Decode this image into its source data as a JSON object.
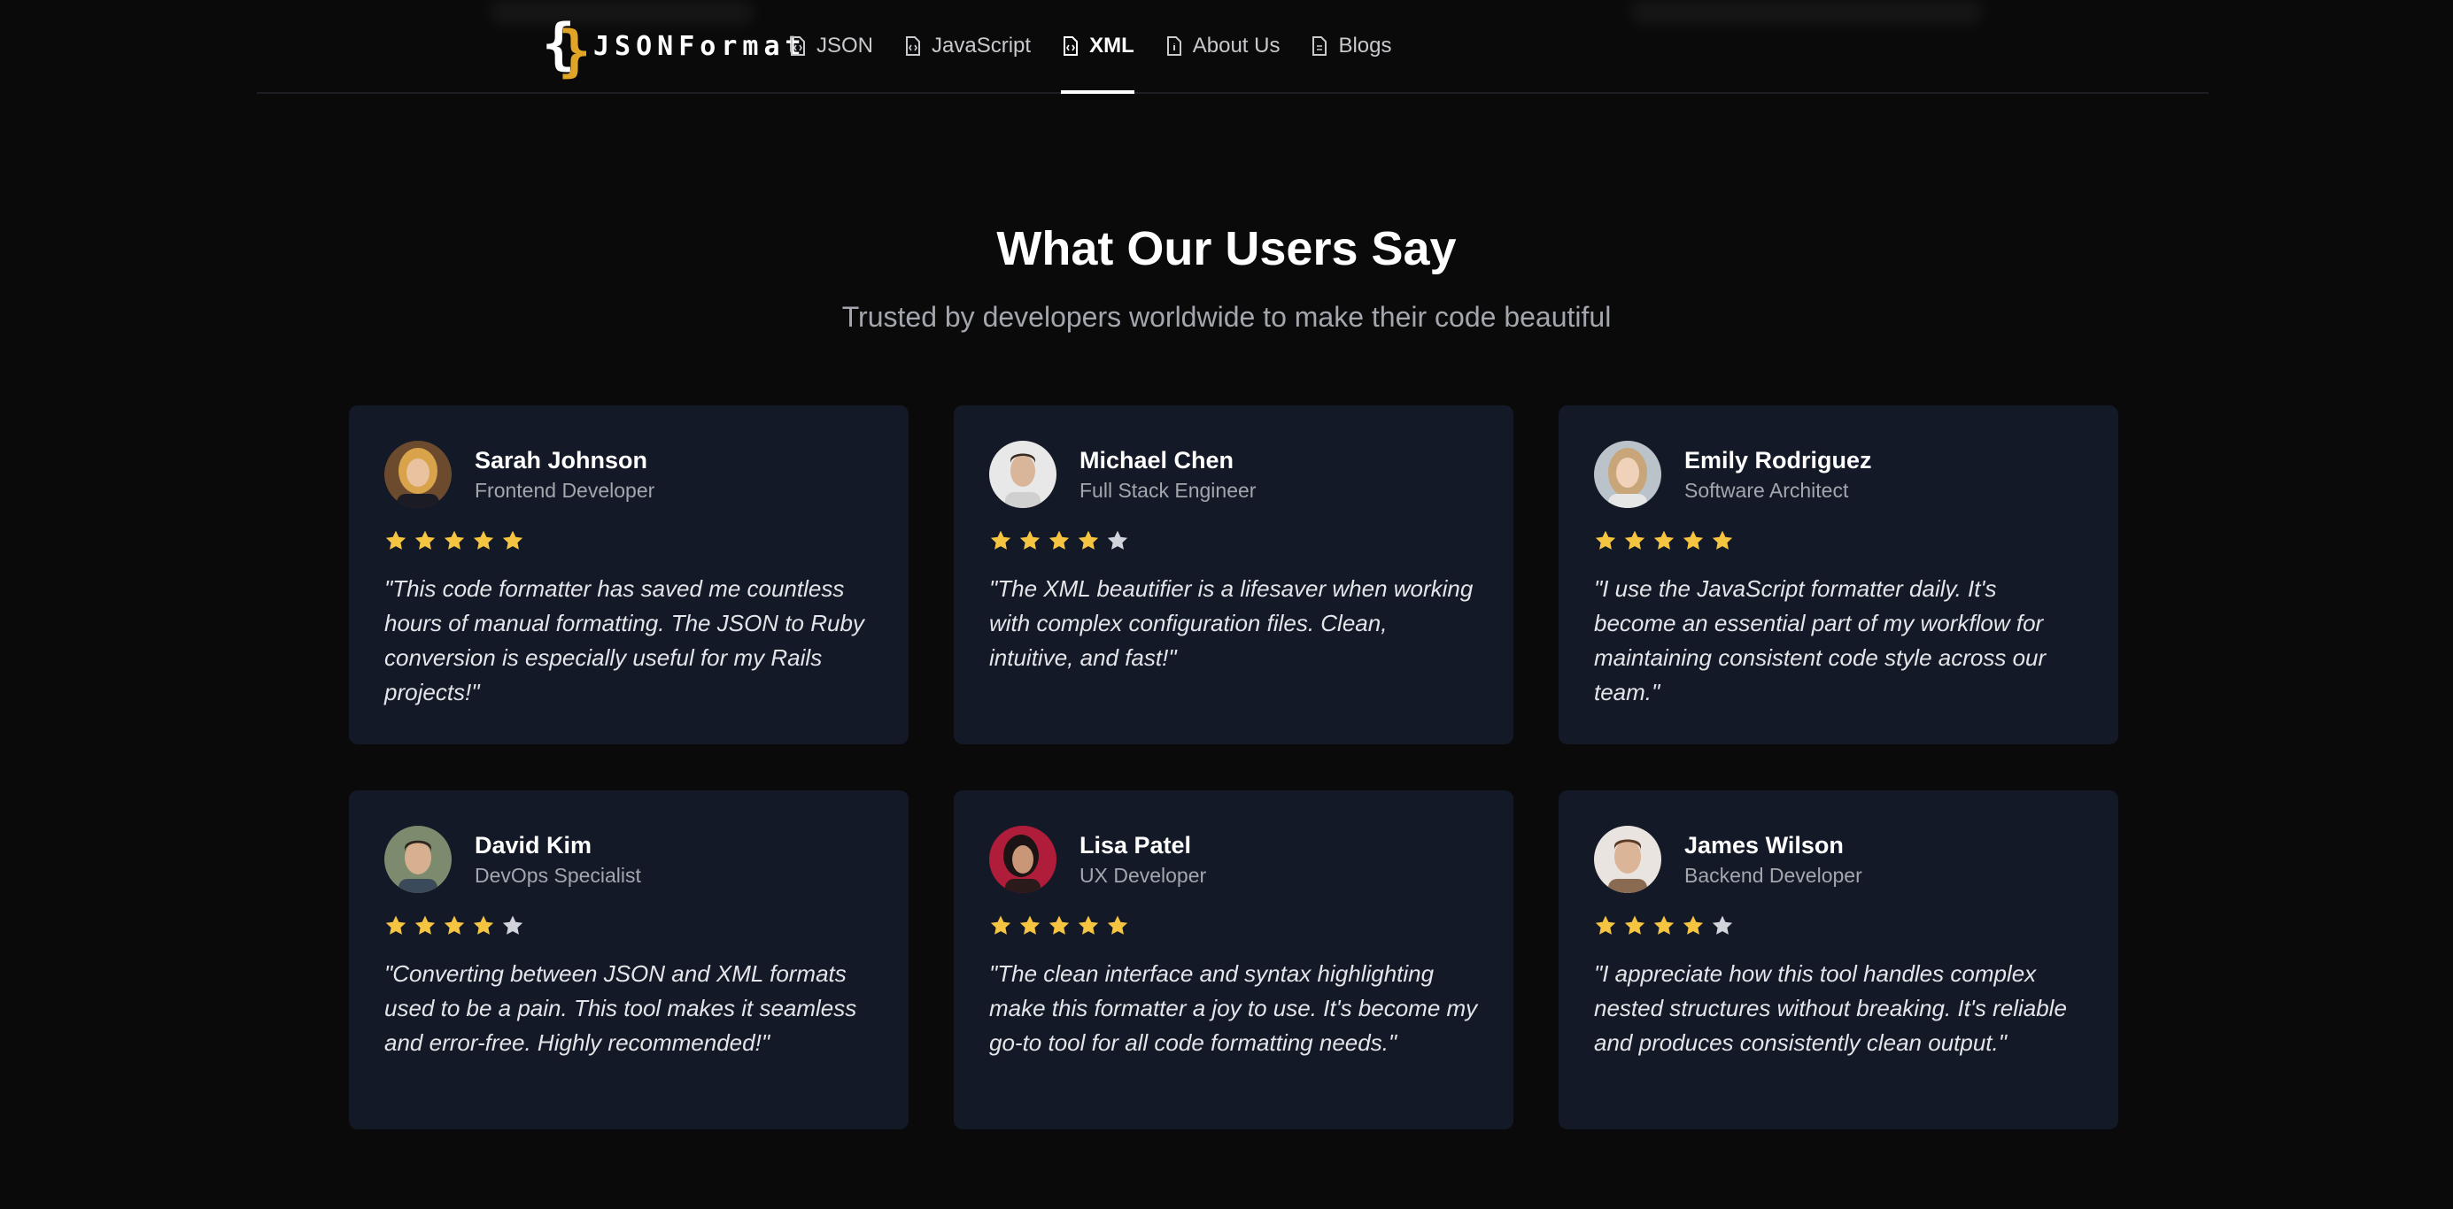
{
  "brand": {
    "logo_text": "JSONFormat",
    "colors": {
      "brace_white": "#ffffff",
      "brace_gold": "#e0a526"
    }
  },
  "nav": {
    "items": [
      {
        "label": "JSON",
        "icon": "file-code-icon",
        "active": false
      },
      {
        "label": "JavaScript",
        "icon": "file-code-icon",
        "active": false
      },
      {
        "label": "XML",
        "icon": "file-code-icon",
        "active": true
      },
      {
        "label": "About Us",
        "icon": "file-info-icon",
        "active": false
      },
      {
        "label": "Blogs",
        "icon": "file-text-icon",
        "active": false
      }
    ]
  },
  "testimonials": {
    "title": "What Our Users Say",
    "subtitle": "Trusted by developers worldwide to make their code beautiful",
    "colors": {
      "card_bg": "#141928",
      "star_filled": "#f5c542",
      "star_empty": "#d1d5db"
    },
    "reviews": [
      {
        "name": "Sarah Johnson",
        "role": "Frontend Developer",
        "rating": 5,
        "quote": "\"This code formatter has saved me countless hours of manual formatting. The JSON to Ruby conversion is especially useful for my Rails projects!\""
      },
      {
        "name": "Michael Chen",
        "role": "Full Stack Engineer",
        "rating": 4,
        "quote": "\"The XML beautifier is a lifesaver when working with complex configuration files. Clean, intuitive, and fast!\""
      },
      {
        "name": "Emily Rodriguez",
        "role": "Software Architect",
        "rating": 5,
        "quote": "\"I use the JavaScript formatter daily. It's become an essential part of my workflow for maintaining consistent code style across our team.\""
      },
      {
        "name": "David Kim",
        "role": "DevOps Specialist",
        "rating": 4,
        "quote": "\"Converting between JSON and XML formats used to be a pain. This tool makes it seamless and error-free. Highly recommended!\""
      },
      {
        "name": "Lisa Patel",
        "role": "UX Developer",
        "rating": 5,
        "quote": "\"The clean interface and syntax highlighting make this formatter a joy to use. It's become my go-to tool for all code formatting needs.\""
      },
      {
        "name": "James Wilson",
        "role": "Backend Developer",
        "rating": 4,
        "quote": "\"I appreciate how this tool handles complex nested structures without breaking. It's reliable and produces consistently clean output.\""
      }
    ]
  }
}
